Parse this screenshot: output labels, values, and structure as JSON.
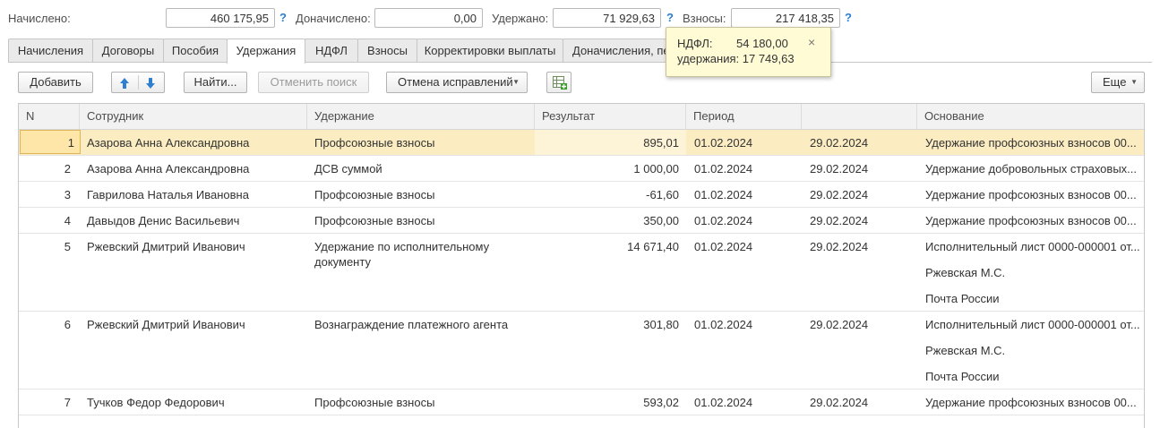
{
  "summary": {
    "nachisleno_label": "Начислено:",
    "nachisleno_value": "460 175,95",
    "donachisleno_label": "Доначислено:",
    "donachisleno_value": "0,00",
    "uderzhano_label": "Удержано:",
    "uderzhano_value": "71 929,63",
    "vznosy_label": "Взносы:",
    "vznosy_value": "217 418,35",
    "help": "?"
  },
  "tooltip": {
    "line1_label": "НДФЛ:",
    "line1_value": "54 180,00",
    "line2": "удержания: 17 749,63",
    "close": "×"
  },
  "tabs": [
    {
      "label": "Начисления"
    },
    {
      "label": "Договоры"
    },
    {
      "label": "Пособия"
    },
    {
      "label": "Удержания",
      "active": true
    },
    {
      "label": "НДФЛ"
    },
    {
      "label": "Взносы"
    },
    {
      "label": "Корректировки выплаты"
    },
    {
      "label": "Доначисления, перерасчеты"
    }
  ],
  "toolbar": {
    "add": "Добавить",
    "find": "Найти...",
    "cancel_search": "Отменить поиск",
    "cancel_fixes": "Отмена исправлений",
    "more": "Еще"
  },
  "table": {
    "headers": [
      "N",
      "Сотрудник",
      "Удержание",
      "Результат",
      "Период",
      "",
      "Основание"
    ],
    "rows": [
      {
        "n": "1",
        "employee": "Азарова Анна Александровна",
        "deduction": [
          "Профсоюзные взносы"
        ],
        "result": "895,01",
        "period_start": "01.02.2024",
        "period_end": "29.02.2024",
        "basis": [
          "Удержание профсоюзных взносов 00..."
        ],
        "selected": true
      },
      {
        "n": "2",
        "employee": "Азарова Анна Александровна",
        "deduction": [
          "ДСВ суммой"
        ],
        "result": "1 000,00",
        "period_start": "01.02.2024",
        "period_end": "29.02.2024",
        "basis": [
          "Удержание добровольных страховых..."
        ]
      },
      {
        "n": "3",
        "employee": "Гаврилова Наталья Ивановна",
        "deduction": [
          "Профсоюзные взносы"
        ],
        "result": "-61,60",
        "period_start": "01.02.2024",
        "period_end": "29.02.2024",
        "basis": [
          "Удержание профсоюзных взносов 00..."
        ]
      },
      {
        "n": "4",
        "employee": "Давыдов Денис Васильевич",
        "deduction": [
          "Профсоюзные взносы"
        ],
        "result": "350,00",
        "period_start": "01.02.2024",
        "period_end": "29.02.2024",
        "basis": [
          "Удержание профсоюзных взносов 00..."
        ]
      },
      {
        "n": "5",
        "employee": "Ржевский Дмитрий Иванович",
        "deduction": [
          "Удержание по исполнительному",
          "документу"
        ],
        "result": "14 671,40",
        "period_start": "01.02.2024",
        "period_end": "29.02.2024",
        "basis": [
          "Исполнительный лист 0000-000001 от...",
          "Ржевская М.С.",
          "Почта России"
        ]
      },
      {
        "n": "6",
        "employee": "Ржевский Дмитрий Иванович",
        "deduction": [
          "Вознаграждение платежного агента"
        ],
        "result": "301,80",
        "period_start": "01.02.2024",
        "period_end": "29.02.2024",
        "basis": [
          "Исполнительный лист 0000-000001 от...",
          "Ржевская М.С.",
          "Почта России"
        ]
      },
      {
        "n": "7",
        "employee": "Тучков Федор Федорович",
        "deduction": [
          "Профсоюзные взносы"
        ],
        "result": "593,02",
        "period_start": "01.02.2024",
        "period_end": "29.02.2024",
        "basis": [
          "Удержание профсоюзных взносов 00..."
        ]
      }
    ]
  },
  "icons": {
    "up": "arrow-up-icon",
    "down": "arrow-down-icon",
    "excel": "spreadsheet-add-icon",
    "dropdown": "chevron-down-icon"
  },
  "colors": {
    "accent": "#2a7fd4",
    "selected_row": "#fbecc1",
    "tooltip_bg": "#fffbd5"
  }
}
